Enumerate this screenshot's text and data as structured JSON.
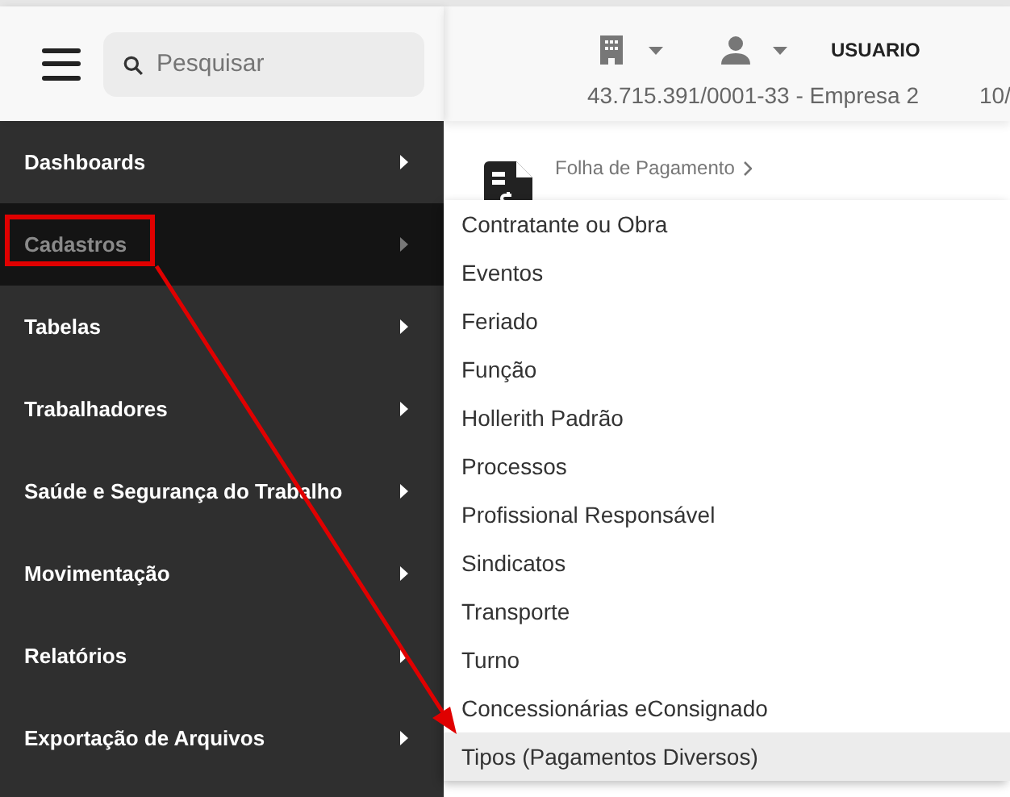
{
  "header": {
    "search": {
      "placeholder": "Pesquisar"
    },
    "user": "USUARIO",
    "company": "43.715.391/0001-33 - Empresa 2",
    "date": "10/"
  },
  "page": {
    "breadcrumb": "Folha de Pagamento"
  },
  "sidebar": {
    "items": [
      {
        "label": "Dashboards",
        "selected": false,
        "highlighted": false
      },
      {
        "label": "Cadastros",
        "selected": true,
        "highlighted": true
      },
      {
        "label": "Tabelas",
        "selected": false,
        "highlighted": false
      },
      {
        "label": "Trabalhadores",
        "selected": false,
        "highlighted": false
      },
      {
        "label": "Saúde e Segurança do Trabalho",
        "selected": false,
        "highlighted": false
      },
      {
        "label": "Movimentação",
        "selected": false,
        "highlighted": false
      },
      {
        "label": "Relatórios",
        "selected": false,
        "highlighted": false
      },
      {
        "label": "Exportação de Arquivos",
        "selected": false,
        "highlighted": false
      }
    ]
  },
  "submenu": {
    "items": [
      {
        "label": "Contratante ou Obra",
        "selected": false
      },
      {
        "label": "Eventos",
        "selected": false
      },
      {
        "label": "Feriado",
        "selected": false
      },
      {
        "label": "Função",
        "selected": false
      },
      {
        "label": "Hollerith Padrão",
        "selected": false
      },
      {
        "label": "Processos",
        "selected": false
      },
      {
        "label": "Profissional Responsável",
        "selected": false
      },
      {
        "label": "Sindicatos",
        "selected": false
      },
      {
        "label": "Transporte",
        "selected": false
      },
      {
        "label": "Turno",
        "selected": false
      },
      {
        "label": "Concessionárias eConsignado",
        "selected": false
      },
      {
        "label": "Tipos (Pagamentos Diversos)",
        "selected": true
      }
    ]
  },
  "annotation": {
    "color": "#e00000"
  }
}
